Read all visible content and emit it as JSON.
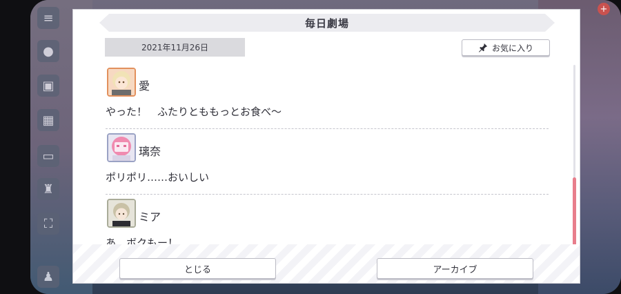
{
  "dialog": {
    "title": "毎日劇場",
    "date": "2021年11月26日",
    "favorite_label": "お気に入り"
  },
  "messages": [
    {
      "name": "愛",
      "text": "やった！　ふたりとももっとお食べ～"
    },
    {
      "name": "璃奈",
      "text": "ポリポリ……おいしい"
    },
    {
      "name": "ミア",
      "text": "あ、ボクもー！"
    }
  ],
  "footer": {
    "close_label": "とじる",
    "archive_label": "アーカイブ"
  },
  "colors": {
    "accent": "#e87e8c",
    "chip_bg": "#dadade"
  }
}
